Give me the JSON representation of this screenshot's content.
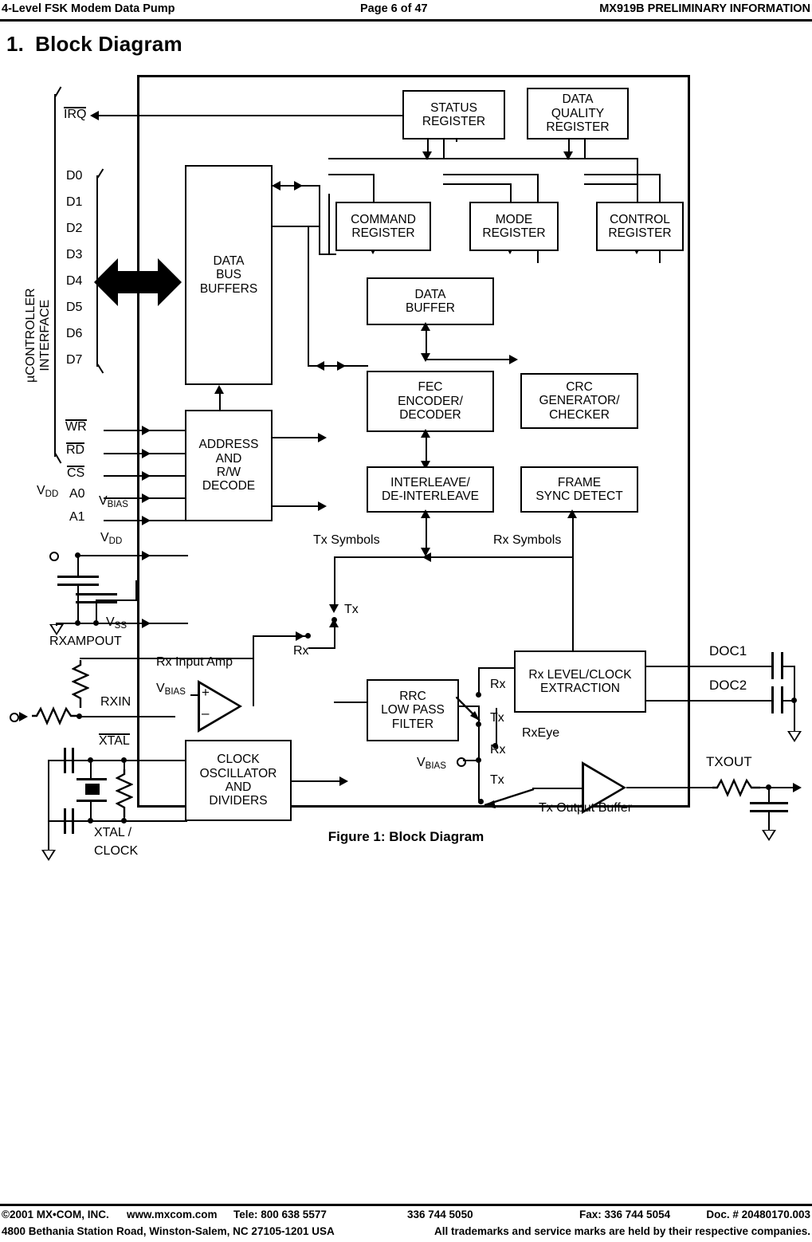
{
  "header": {
    "left": "4-Level FSK Modem Data Pump",
    "center": "Page 6 of 47",
    "right": "MX919B PRELIMINARY INFORMATION"
  },
  "section": {
    "number": "1.",
    "title": "Block Diagram"
  },
  "figure": {
    "caption": "Figure 1:  Block Diagram"
  },
  "footer": {
    "copyright": "©2001 MX•COM, INC.",
    "web": "www.mxcom.com",
    "tele_label": "Tele:  800 638 5577",
    "tele_alt": "336 744 5050",
    "fax": "Fax:  336 744 5054",
    "doc": "Doc. # 20480170.003",
    "address": "4800 Bethania Station Road, Winston-Salem, NC 27105-1201 USA",
    "trademarks": "All trademarks and service marks are held by their respective companies."
  },
  "diagram": {
    "interface_label_line1": "µCONTROLLER",
    "interface_label_line2": "INTERFACE",
    "bus_width": "8",
    "pins": {
      "irq": "IRQ",
      "data": [
        "D0",
        "D1",
        "D2",
        "D3",
        "D4",
        "D5",
        "D6",
        "D7"
      ],
      "ctrl": [
        "WR",
        "RD",
        "CS",
        "A0",
        "A1"
      ],
      "vdd": "VDD",
      "vdd_ext": "VDD",
      "vbias": "VBIAS",
      "vss": "VSS",
      "rxampout": "RXAMPOUT",
      "rxin": "RXIN",
      "xtal": "XTAL",
      "xtal_clock_l1": "XTAL /",
      "xtal_clock_l2": "CLOCK",
      "doc1": "DOC1",
      "doc2": "DOC2",
      "txout": "TXOUT"
    },
    "blocks": {
      "data_bus_buffers": [
        "DATA",
        "BUS",
        "BUFFERS"
      ],
      "address_decode": [
        "ADDRESS",
        "AND",
        "R/W",
        "DECODE"
      ],
      "status_register": [
        "STATUS",
        "REGISTER"
      ],
      "data_quality_register": [
        "DATA",
        "QUALITY",
        "REGISTER"
      ],
      "command_register": [
        "COMMAND",
        "REGISTER"
      ],
      "mode_register": [
        "MODE",
        "REGISTER"
      ],
      "control_register": [
        "CONTROL",
        "REGISTER"
      ],
      "data_buffer": [
        "DATA",
        "BUFFER"
      ],
      "crc": [
        "CRC",
        "GENERATOR/",
        "CHECKER"
      ],
      "fec": [
        "FEC",
        "ENCODER/",
        "DECODER"
      ],
      "interleave": [
        "INTERLEAVE/",
        "DE-INTERLEAVE"
      ],
      "frame_sync": [
        "FRAME",
        "SYNC DETECT"
      ],
      "rrc": [
        "RRC",
        "LOW PASS",
        "FILTER"
      ],
      "rx_level_clock": [
        "Rx LEVEL/CLOCK",
        "EXTRACTION"
      ],
      "clock_osc": [
        "CLOCK",
        "OSCILLATOR",
        "AND",
        "DIVIDERS"
      ]
    },
    "signals": {
      "tx_symbols": "Tx Symbols",
      "rx_symbols": "Rx Symbols",
      "rx_input_amp": "Rx Input Amp",
      "tx_output_buffer": "Tx Output Buffer",
      "rxeye": "RxEye",
      "vbias_amp": "VBIAS",
      "vbias_sw": "VBIAS",
      "tx_a": "Tx",
      "rx_a": "Rx",
      "sw_rx1": "Rx",
      "sw_tx1": "Tx",
      "sw_rx2": "Rx",
      "sw_tx2": "Tx",
      "plus": "+",
      "minus": "–"
    }
  }
}
